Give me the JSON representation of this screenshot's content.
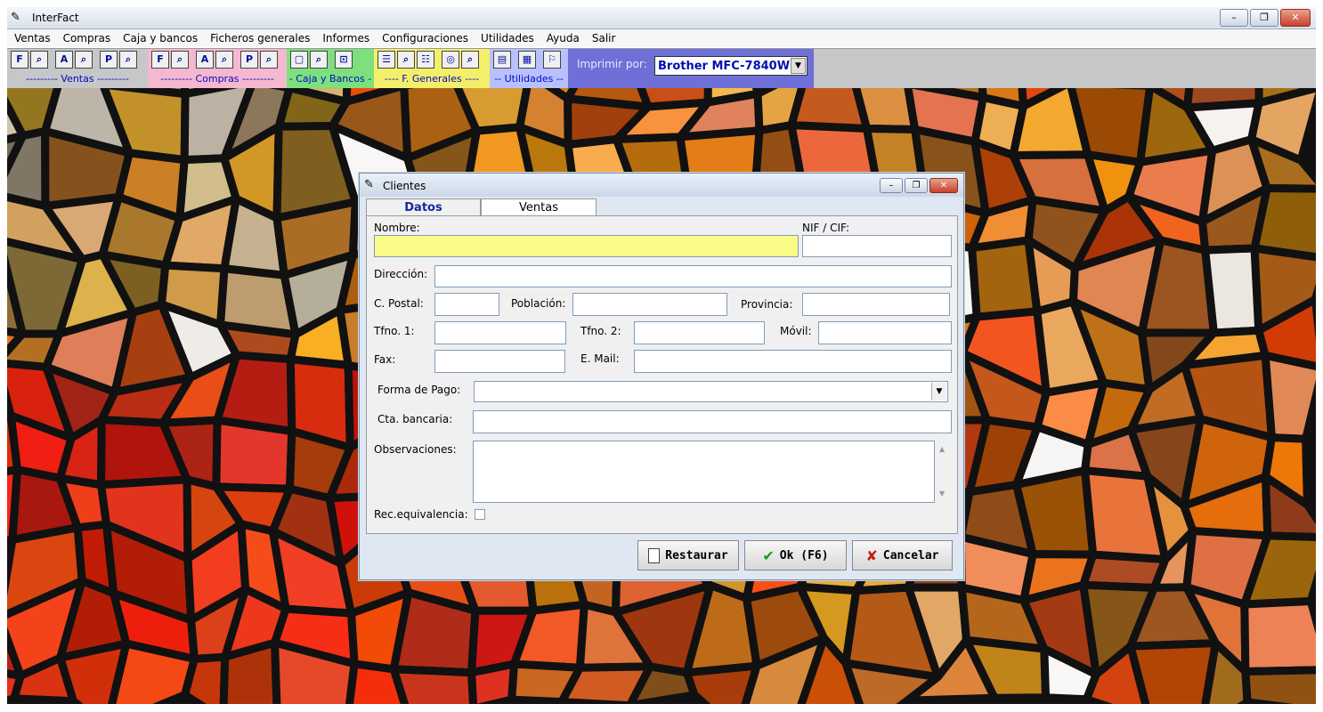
{
  "window": {
    "title": "InterFact",
    "minimize": "–",
    "restore": "❐",
    "close": "✕"
  },
  "menu": [
    "Ventas",
    "Compras",
    "Caja y bancos",
    "Ficheros generales",
    "Informes",
    "Configuraciones",
    "Utilidades",
    "Ayuda",
    "Salir"
  ],
  "toolbar": {
    "groups": [
      {
        "label": "--------- Ventas ---------"
      },
      {
        "label": "--------- Compras ---------"
      },
      {
        "label": "- Caja y Bancos -"
      },
      {
        "label": "---- F. Generales ----"
      },
      {
        "label": "-- Utilidades --"
      }
    ],
    "print_label": "Imprimir por:",
    "printer": "Brother MFC-7840W",
    "colors": {
      "compras": "#f5b8d0",
      "caja": "#7de07d",
      "fgenerales": "#f4ef6a",
      "utilidades": "#b8c0ff",
      "printer": "#6f6fd8"
    }
  },
  "dialog": {
    "title": "Clientes",
    "tabs": [
      "Datos",
      "Ventas"
    ],
    "fields": {
      "nombre": {
        "label": "Nombre:",
        "value": ""
      },
      "nif": {
        "label": "NIF / CIF:",
        "value": ""
      },
      "direccion": {
        "label": "Dirección:",
        "value": ""
      },
      "cpostal": {
        "label": "C. Postal:",
        "value": ""
      },
      "poblacion": {
        "label": "Población:",
        "value": ""
      },
      "provincia": {
        "label": "Provincia:",
        "value": ""
      },
      "tfno1": {
        "label": "Tfno. 1:",
        "value": ""
      },
      "tfno2": {
        "label": "Tfno. 2:",
        "value": ""
      },
      "movil": {
        "label": "Móvil:",
        "value": ""
      },
      "fax": {
        "label": "Fax:",
        "value": ""
      },
      "email": {
        "label": "E. Mail:",
        "value": ""
      },
      "forma_pago": {
        "label": "Forma de Pago:",
        "value": ""
      },
      "cta_bancaria": {
        "label": "Cta. bancaria:",
        "value": ""
      },
      "observaciones": {
        "label": "Observaciones:",
        "value": ""
      },
      "rec_equivalencia": {
        "label": "Rec.equivalencia:",
        "checked": false
      }
    },
    "buttons": {
      "restaurar": "Restaurar",
      "ok": "Ok (F6)",
      "cancelar": "Cancelar"
    }
  }
}
